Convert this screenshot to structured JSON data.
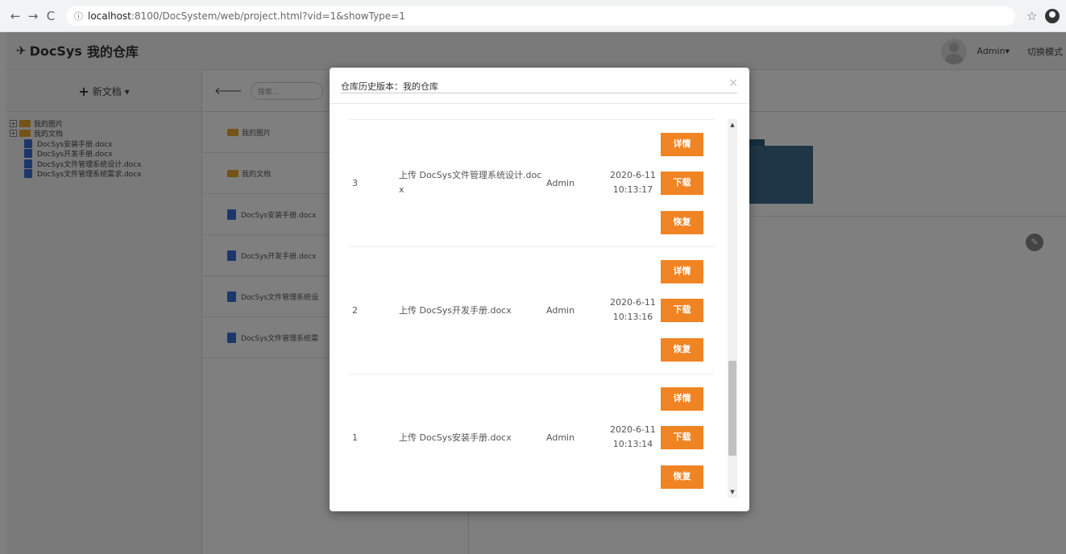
{
  "browser": {
    "back_icon": "←",
    "forward_icon": "→",
    "reload_icon": "C",
    "info_icon": "ⓘ",
    "url_host": "localhost",
    "url_rest": ":8100/DocSystem/web/project.html?vid=1&showType=1",
    "star_icon": "☆"
  },
  "header": {
    "brand_icon": "✈",
    "brand_name": "DocSys",
    "repo_name": "我的仓库",
    "user": "Admin▾",
    "switch_mode": "切换模式"
  },
  "left": {
    "new_doc_label": "新文档 ▾",
    "tree": [
      {
        "label": "我的图片",
        "type": "folder"
      },
      {
        "label": "我的文档",
        "type": "folder"
      },
      {
        "label": "DocSys安装手册.docx",
        "type": "file"
      },
      {
        "label": "DocSys开发手册.docx",
        "type": "file"
      },
      {
        "label": "DocSys文件管理系统设计.docx",
        "type": "file"
      },
      {
        "label": "DocSys文件管理系统需求.docx",
        "type": "file"
      }
    ]
  },
  "middle": {
    "search_placeholder": "搜索...",
    "items": [
      {
        "label": "我的图片",
        "type": "folder"
      },
      {
        "label": "我的文档",
        "type": "folder"
      },
      {
        "label": "DocSys安装手册.docx",
        "type": "file"
      },
      {
        "label": "DocSys开发手册.docx",
        "type": "file"
      },
      {
        "label": "DocSys文件管理系统设",
        "type": "file"
      },
      {
        "label": "DocSys文件管理系统需",
        "type": "file"
      }
    ]
  },
  "modal": {
    "title": "仓库历史版本：我的仓库",
    "close_icon": "×",
    "rows": [
      {
        "version": "3",
        "desc": "上传 DocSys文件管理系统设计.docx",
        "user": "Admin",
        "date": "2020-6-11",
        "time": "10:13:17",
        "btn_detail": "详情",
        "btn_download": "下载",
        "btn_restore": "恢复"
      },
      {
        "version": "2",
        "desc": "上传 DocSys开发手册.docx",
        "user": "Admin",
        "date": "2020-6-11",
        "time": "10:13:16",
        "btn_detail": "详情",
        "btn_download": "下载",
        "btn_restore": "恢复"
      },
      {
        "version": "1",
        "desc": "上传 DocSys安装手册.docx",
        "user": "Admin",
        "date": "2020-6-11",
        "time": "10:13:14",
        "btn_detail": "详情",
        "btn_download": "下载",
        "btn_restore": "恢复"
      }
    ],
    "scroll_up_icon": "▲",
    "scroll_down_icon": "▼"
  },
  "colors": {
    "accent_orange": "#f08322",
    "folder": "#e8a72e",
    "file": "#3b6fd4"
  }
}
